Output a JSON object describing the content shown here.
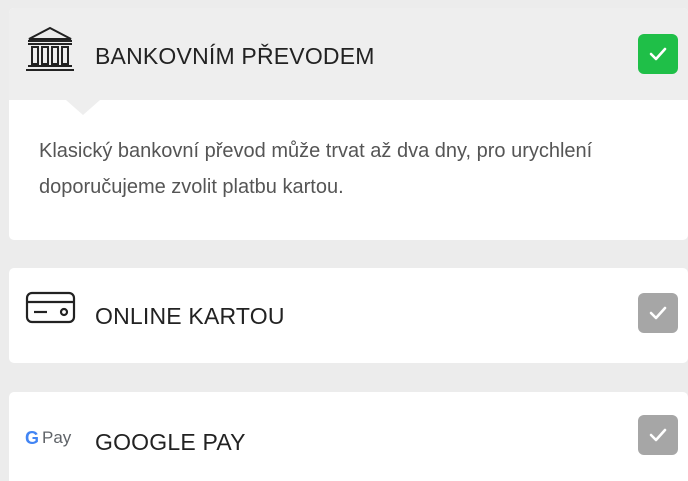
{
  "payment_options": {
    "bank_transfer": {
      "label": "BANKOVNÍM PŘEVODEM",
      "icon": "bank-icon",
      "selected": true,
      "description": "Klasický bankovní převod může trvat až dva dny, pro urychlení doporučujeme zvolit platbu kartou."
    },
    "card": {
      "label": "ONLINE KARTOU",
      "icon": "credit-card-icon",
      "selected": false
    },
    "google_pay": {
      "label": "GOOGLE PAY",
      "icon": "google-pay-icon",
      "logo_text": "Pay",
      "selected": false
    }
  },
  "colors": {
    "selected_check": "#1fbf48",
    "unselected_check": "#a6a6a6",
    "header_bg": "#eeeeee",
    "page_bg": "#ececec"
  }
}
